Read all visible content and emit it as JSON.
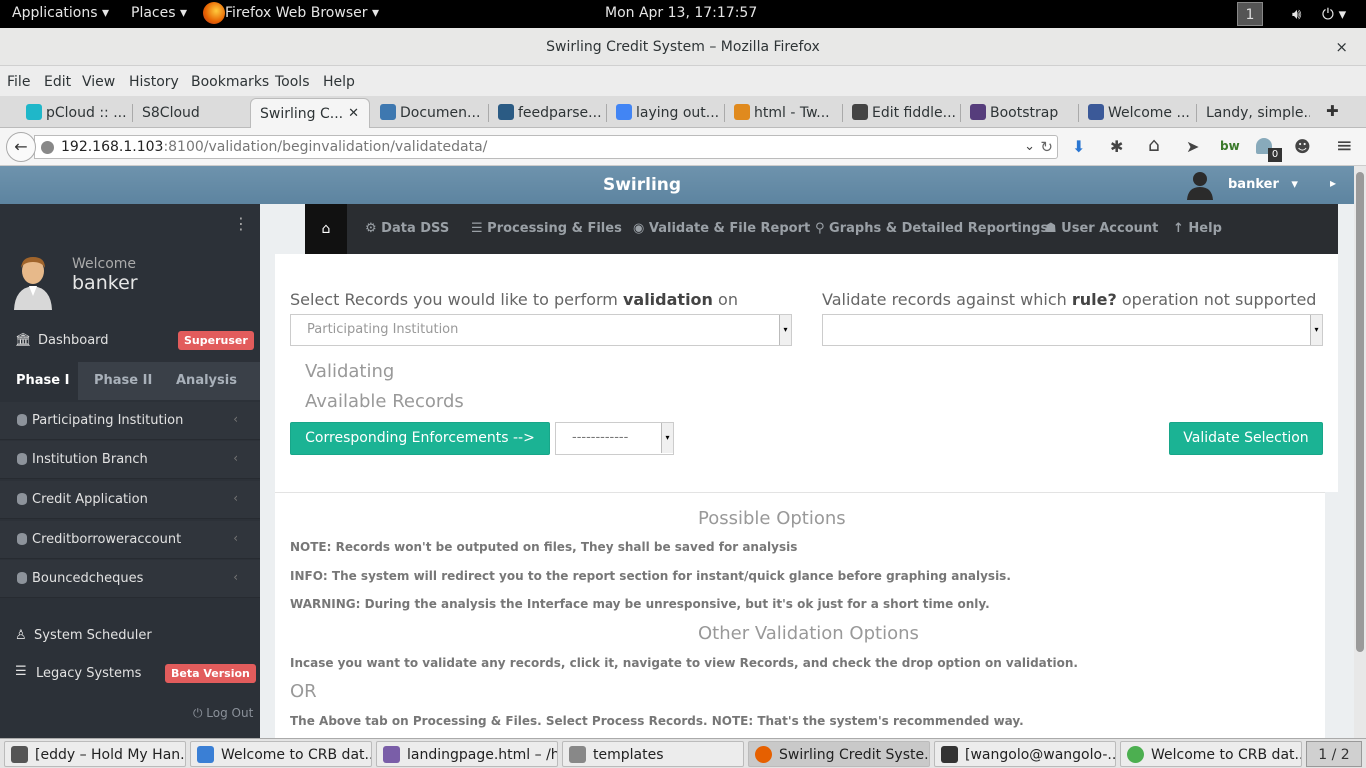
{
  "topbar": {
    "applications": "Applications ▾",
    "places": "Places ▾",
    "app": "Firefox Web Browser ▾",
    "clock": "Mon Apr 13, 17:17:57",
    "workspace": "1",
    "volume_icon": "volume-icon",
    "power_icon": "power-icon"
  },
  "window": {
    "title": "Swirling Credit System – Mozilla Firefox",
    "close": "×"
  },
  "menubar": [
    "File",
    "Edit",
    "View",
    "History",
    "Bookmarks",
    "Tools",
    "Help"
  ],
  "tabs": [
    {
      "label": "pCloud :: ...",
      "color": "#1fb7c9"
    },
    {
      "label": "S8Cloud",
      "color": ""
    },
    {
      "label": "Swirling C...",
      "color": ""
    },
    {
      "label": "Documen...",
      "color": "#3e78b0"
    },
    {
      "label": "feedparse...",
      "color": "#2b5b84"
    },
    {
      "label": "laying out...",
      "color": "#4285f4"
    },
    {
      "label": "html - Tw...",
      "color": "#e08a1e"
    },
    {
      "label": "Edit fiddle...",
      "color": "#444444"
    },
    {
      "label": "Bootstrap",
      "color": "#563d7c"
    },
    {
      "label": "Welcome ...",
      "color": "#3b5998"
    },
    {
      "label": "Landy, simple...",
      "color": ""
    }
  ],
  "tab_close": "✕",
  "new_tab": "✚",
  "url": {
    "host": "192.168.1.103",
    "rest": ":8100/validation/beginvalidation/validatedata/"
  },
  "navbar": {
    "back": "←",
    "reload": "↻",
    "dropdown": "⌄",
    "download": "⬇",
    "gear": "✱",
    "home": "⌂",
    "send": "➤",
    "bw": "bw",
    "ghost_count": "0",
    "chat": "☻",
    "menu": "≡"
  },
  "app": {
    "brand": "Swirling",
    "user": "banker",
    "user_caret": "▾",
    "header_arrow": "▸"
  },
  "sidebar": {
    "dots": "⋮",
    "welcome": "Welcome",
    "name": "banker",
    "dashboard": "Dashboard",
    "superuser": "Superuser",
    "phase_tabs": [
      "Phase I",
      "Phase II",
      "Analysis"
    ],
    "items": [
      "Participating Institution",
      "Institution Branch",
      "Credit Application",
      "Creditborroweraccount",
      "Bouncedcheques"
    ],
    "item_chev": "‹",
    "scheduler": "System Scheduler",
    "legacy": "Legacy Systems",
    "beta": "Beta Version",
    "logout": "⏻ Log Out"
  },
  "topnav": {
    "home": "⌂",
    "items": [
      "⚙ Data DSS",
      "☰ Processing & Files",
      "◉ Validate & File Report",
      "⚲ Graphs & Detailed Reportings",
      "☗ User Account",
      "↑ Help"
    ]
  },
  "form": {
    "left_label_pre": "Select Records you would like to perform ",
    "left_label_bold": "validation",
    "left_label_post": " on",
    "left_select": "Participating Institution",
    "right_label_pre": "Validate records against which ",
    "right_label_bold": "rule?",
    "right_label_post": " operation not supported",
    "right_select": "",
    "validating": "Validating",
    "available": "Available Records",
    "enforce_button": "Corresponding Enforcements -->",
    "enforce_select": "------------",
    "validate_button": "Validate Selection",
    "select_arrow": "▾"
  },
  "options": {
    "heading": "Possible Options",
    "note": "NOTE: Records won't be outputed on files, They shall be saved for analysis",
    "info": "INFO: The system will redirect you to the report section for instant/quick glance before graphing analysis.",
    "warning": "WARNING: During the analysis the Interface may be unresponsive, but it's ok just for a short time only.",
    "other_heading": "Other Validation Options",
    "incase": "Incase you want to validate any records, click it, navigate to view Records, and check the drop option on validation.",
    "or": "OR",
    "above": "The Above tab on Processing & Files. Select Process Records. NOTE: That's the system's recommended way."
  },
  "taskbar": [
    {
      "label": "[eddy – Hold My Han...",
      "color": "#555555"
    },
    {
      "label": "Welcome to CRB dat...",
      "color": "#3a7fd5"
    },
    {
      "label": "landingpage.html – /h...",
      "color": "#7a5ea8"
    },
    {
      "label": "templates",
      "color": "#888888"
    },
    {
      "label": "Swirling Credit Syste...",
      "color": "#e66000"
    },
    {
      "label": "[wangolo@wangolo-...",
      "color": "#333333"
    },
    {
      "label": "Welcome to CRB dat...",
      "color": "#4caf50"
    }
  ],
  "pager": "1 / 2"
}
